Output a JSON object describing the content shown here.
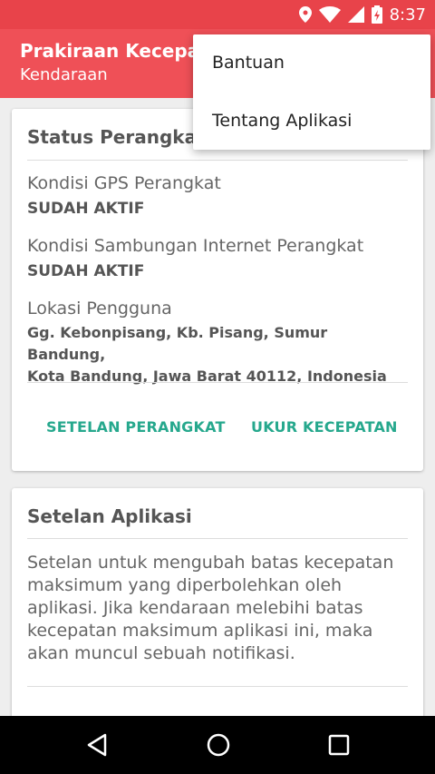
{
  "status_bar": {
    "time": "8:37",
    "icons": [
      "location-icon",
      "wifi-icon",
      "signal-icon",
      "battery-icon"
    ]
  },
  "app_bar": {
    "title": "Prakiraan Kecepatan",
    "subtitle": "Kendaraan"
  },
  "overflow_menu": {
    "items": [
      {
        "label": "Bantuan"
      },
      {
        "label": "Tentang Aplikasi"
      }
    ]
  },
  "device_status_card": {
    "title": "Status Perangkat",
    "gps_label": "Kondisi GPS Perangkat",
    "gps_value": "SUDAH AKTIF",
    "internet_label": "Kondisi Sambungan Internet Perangkat",
    "internet_value": "SUDAH AKTIF",
    "location_label": "Lokasi Pengguna",
    "location_line1": "Gg. Kebonpisang, Kb. Pisang, Sumur Bandung,",
    "location_line2": "Kota Bandung, Jawa Barat 40112, Indonesia",
    "device_settings_button": "SETELAN PERANGKAT",
    "measure_speed_button": "UKUR KECEPATAN"
  },
  "app_settings_card": {
    "title": "Setelan Aplikasi",
    "description": "Setelan untuk mengubah batas kecepatan maksimum yang diperbolehkan oleh aplikasi. Jika kendaraan melebihi batas kecepatan maksimum aplikasi ini, maka akan muncul sebuah notifikasi."
  },
  "nav_bar": {
    "buttons": [
      "back-icon",
      "home-icon",
      "recents-icon"
    ]
  },
  "colors": {
    "status_bar": "#e8434a",
    "app_bar": "#ef5057",
    "accent": "#26a88d"
  }
}
